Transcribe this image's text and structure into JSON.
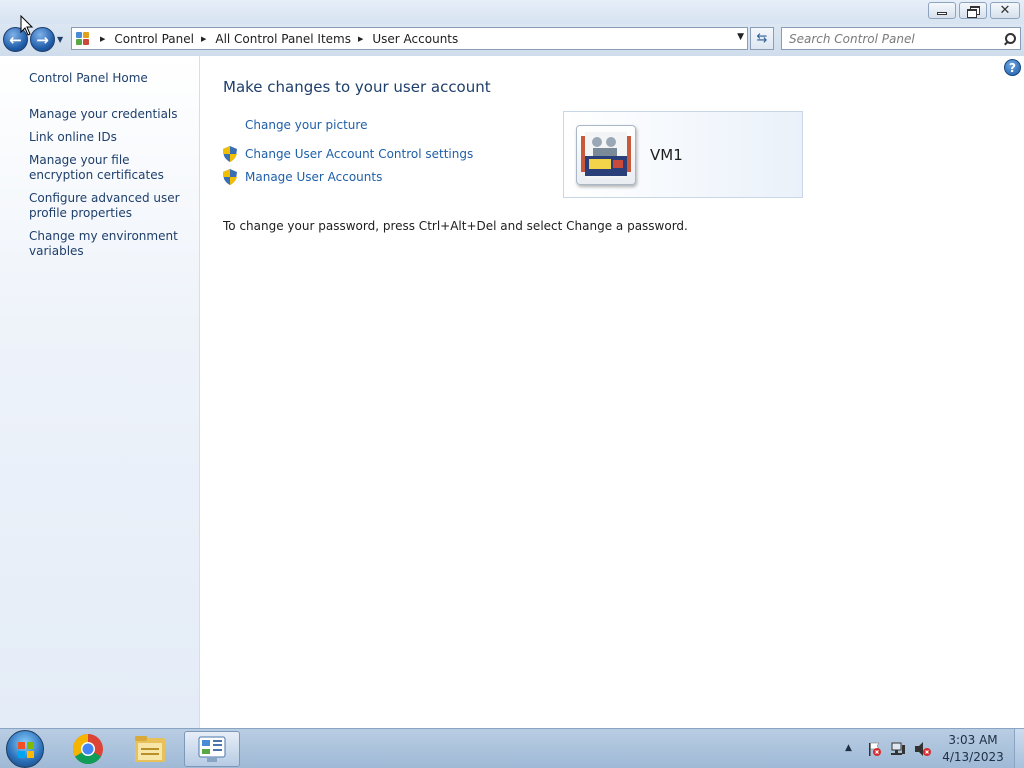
{
  "window": {
    "minimize_label": "",
    "maximize_label": "",
    "close_label": ""
  },
  "address": {
    "crumbs": [
      "Control Panel",
      "All Control Panel Items",
      "User Accounts"
    ]
  },
  "search": {
    "placeholder": "Search Control Panel"
  },
  "sidebar": {
    "items": [
      {
        "label": "Control Panel Home"
      },
      {
        "label": "Manage your credentials"
      },
      {
        "label": "Link online IDs"
      },
      {
        "label": "Manage your file encryption certificates"
      },
      {
        "label": "Configure advanced user profile properties"
      },
      {
        "label": "Change my environment variables"
      }
    ]
  },
  "main": {
    "title": "Make changes to your user account",
    "tasks": [
      {
        "label": "Change your picture",
        "icon": "none"
      },
      {
        "label": "Change User Account Control settings",
        "icon": "uac-shield-icon"
      },
      {
        "label": "Manage User Accounts",
        "icon": "uac-shield-icon"
      }
    ],
    "info": "To change your password, press Ctrl+Alt+Del and select Change a password.",
    "user": {
      "name": "VM1"
    }
  },
  "taskbar": {
    "apps": [
      "chrome-icon",
      "windows-explorer-icon",
      "control-panel-icon"
    ],
    "time": "3:03 AM",
    "date": "4/13/2023"
  },
  "colors": {
    "link": "#1e5fa8",
    "heading": "#1e3f6b",
    "sidebar_bg": "#e4ecf7"
  }
}
